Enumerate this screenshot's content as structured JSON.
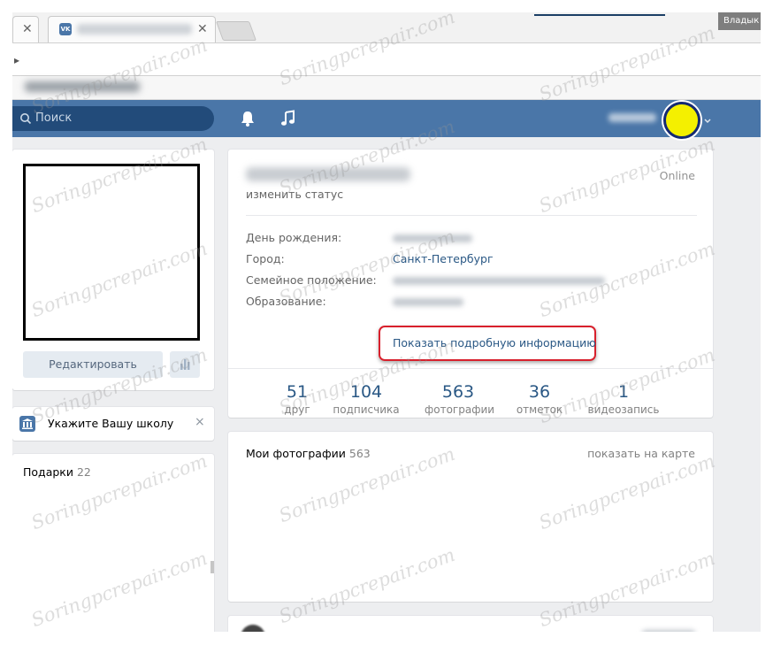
{
  "browser": {
    "window_label": "Владык",
    "vk_favicon": "vk-logo"
  },
  "header": {
    "search_placeholder": "Поиск",
    "icons": [
      "bell-icon",
      "music-icon"
    ],
    "accent_color": "#4a76a8"
  },
  "left": {
    "edit_button": "Редактировать",
    "school_prompt": "Укажите Вашу школу",
    "school_close": "×",
    "gifts_title": "Подарки",
    "gifts_count": "22"
  },
  "profile": {
    "change_status": "изменить статус",
    "online": "Online",
    "rows": [
      {
        "label": "День рождения:",
        "value": ""
      },
      {
        "label": "Город:",
        "value": "Санкт-Петербург"
      },
      {
        "label": "Семейное положение:",
        "value": ""
      },
      {
        "label": "Образование:",
        "value": ""
      }
    ],
    "more_info": "Показать подробную информацию",
    "counters": [
      {
        "num": "51",
        "label": "друг"
      },
      {
        "num": "104",
        "label": "подписчика"
      },
      {
        "num": "563",
        "label": "фотографии"
      },
      {
        "num": "36",
        "label": "отметок"
      },
      {
        "num": "1",
        "label": "видеозапись"
      }
    ]
  },
  "photos": {
    "title": "Мои фотографии",
    "count": "563",
    "map_link": "показать на карте"
  },
  "watermark": "Soringpcrepair.com",
  "highlight_color": "#d8202c"
}
